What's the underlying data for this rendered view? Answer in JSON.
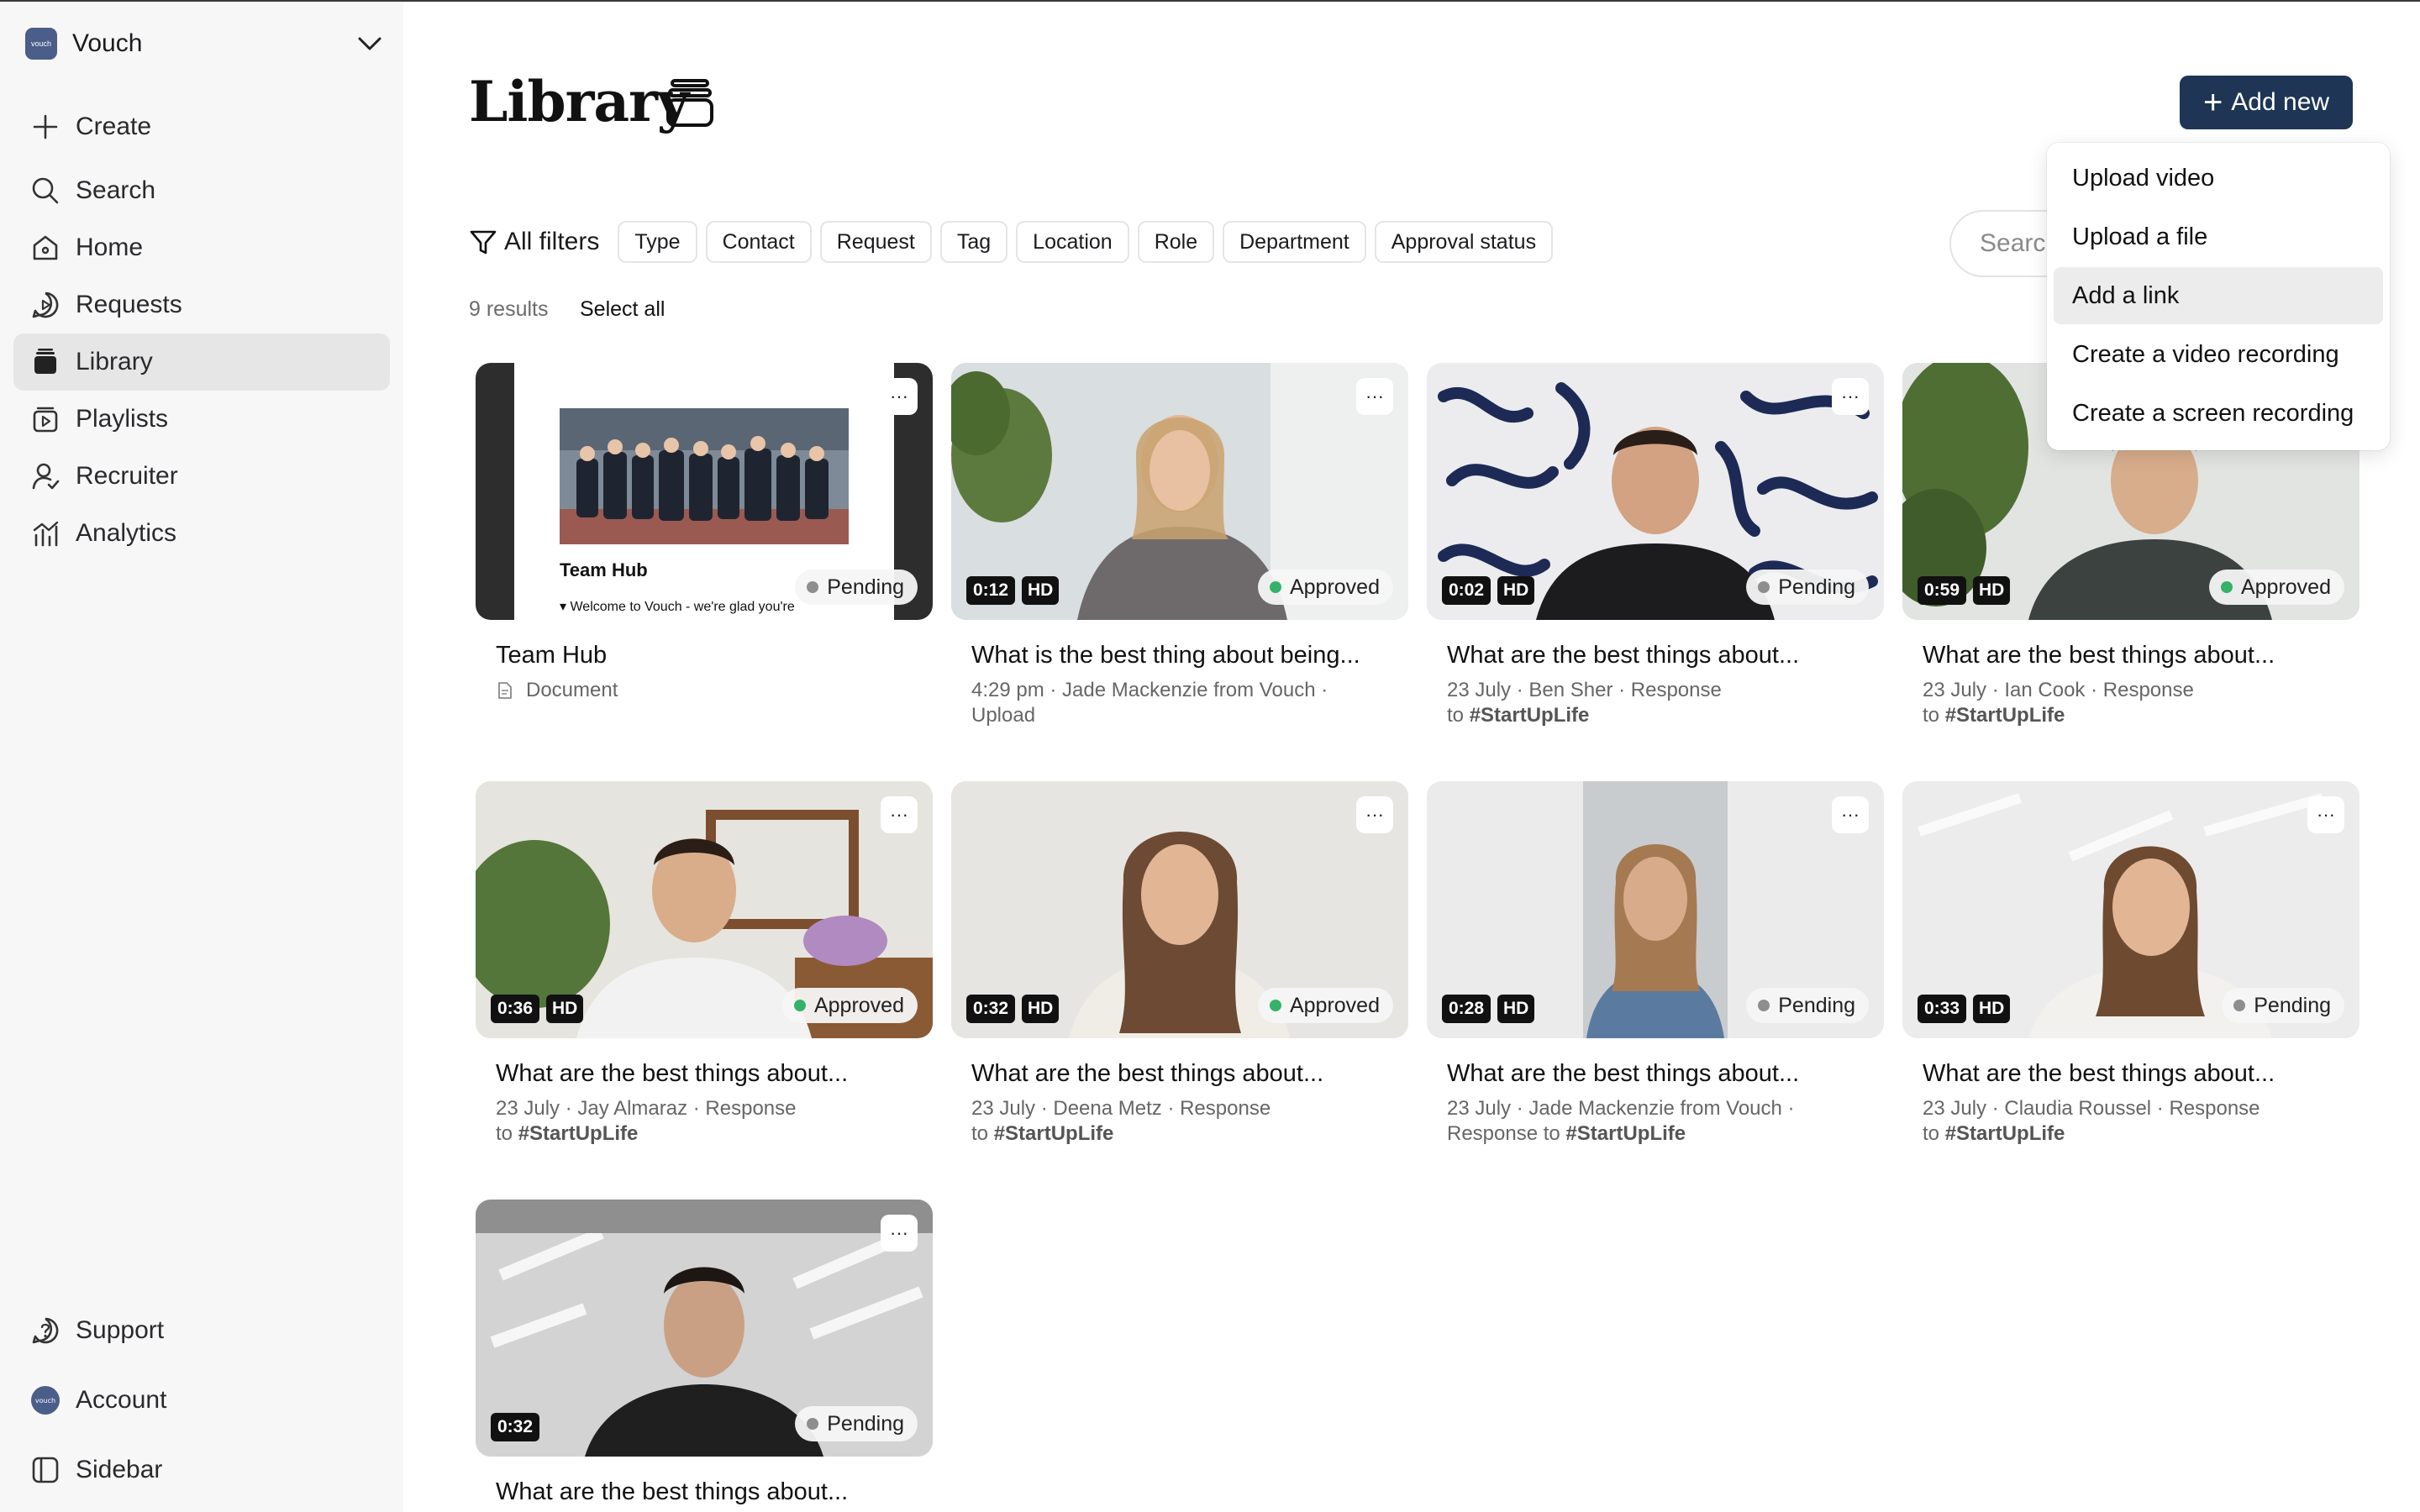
{
  "workspace": {
    "name": "Vouch",
    "logo_text": "vouch"
  },
  "sidebar": {
    "top_items": [
      {
        "label": "Create",
        "icon": "plus-icon"
      },
      {
        "label": "Search",
        "icon": "search-icon"
      },
      {
        "label": "Home",
        "icon": "home-icon"
      },
      {
        "label": "Requests",
        "icon": "requests-icon"
      },
      {
        "label": "Library",
        "icon": "library-icon",
        "active": true
      },
      {
        "label": "Playlists",
        "icon": "playlists-icon"
      },
      {
        "label": "Recruiter",
        "icon": "recruiter-icon"
      },
      {
        "label": "Analytics",
        "icon": "analytics-icon"
      }
    ],
    "bottom_items": [
      {
        "label": "Support",
        "icon": "support-icon"
      },
      {
        "label": "Account",
        "icon": "avatar"
      },
      {
        "label": "Sidebar",
        "icon": "sidebar-toggle-icon"
      }
    ]
  },
  "page": {
    "title": "Library"
  },
  "add_new": {
    "label": "Add new"
  },
  "filters": {
    "all_label": "All filters",
    "chips": [
      "Type",
      "Contact",
      "Request",
      "Tag",
      "Location",
      "Role",
      "Department",
      "Approval status"
    ]
  },
  "search": {
    "placeholder": "Search"
  },
  "results": {
    "count_label": "9 results",
    "select_all": "Select all"
  },
  "menu": {
    "items": [
      "Upload video",
      "Upload a file",
      "Add a link",
      "Create a video recording",
      "Create a screen recording"
    ],
    "highlighted_index": 2
  },
  "cards": [
    {
      "title": "Team Hub",
      "meta": "Document",
      "status": "Pending",
      "duration": "",
      "hd": false,
      "thumb_text": {
        "heading": "Team Hub",
        "sub": "▾ Welcome to Vouch - we're glad you're"
      }
    },
    {
      "title": "What is the best thing about being...",
      "meta": "4:29 pm · Jade Mackenzie from Vouch ·",
      "meta2": "Upload",
      "status": "Approved",
      "duration": "0:12",
      "hd": true
    },
    {
      "title": "What are the best things about...",
      "meta": "23 July · Ben Sher · Response",
      "meta2_prefix": "to ",
      "meta2_bold": "#StartUpLife",
      "status": "Pending",
      "duration": "0:02",
      "hd": true
    },
    {
      "title": "What are the best things about...",
      "meta": "23 July · Ian Cook · Response",
      "meta2_prefix": "to ",
      "meta2_bold": "#StartUpLife",
      "status": "Approved",
      "duration": "0:59",
      "hd": true
    },
    {
      "title": "What are the best things about...",
      "meta": "23 July · Jay Almaraz · Response",
      "meta2_prefix": "to ",
      "meta2_bold": "#StartUpLife",
      "status": "Approved",
      "duration": "0:36",
      "hd": true
    },
    {
      "title": "What are the best things about...",
      "meta": "23 July · Deena Metz · Response",
      "meta2_prefix": "to ",
      "meta2_bold": "#StartUpLife",
      "status": "Approved",
      "duration": "0:32",
      "hd": true
    },
    {
      "title": "What are the best things about...",
      "meta": "23 July · Jade Mackenzie from Vouch ·",
      "meta2_prefix": "Response to ",
      "meta2_bold": "#StartUpLife",
      "status": "Pending",
      "duration": "0:28",
      "hd": true
    },
    {
      "title": "What are the best things about...",
      "meta": "23 July · Claudia Roussel · Response",
      "meta2_prefix": "to ",
      "meta2_bold": "#StartUpLife",
      "status": "Pending",
      "duration": "0:33",
      "hd": true
    },
    {
      "title": "What are the best things about...",
      "meta": "",
      "status": "Pending",
      "duration": "0:32",
      "hd": false
    }
  ],
  "hd_label": "HD",
  "more_label": "···",
  "colors": {
    "approved": "#34b26a",
    "pending": "#8e8e8e",
    "accent": "#1e3555",
    "sidebar_bg": "#f7f7f7"
  }
}
